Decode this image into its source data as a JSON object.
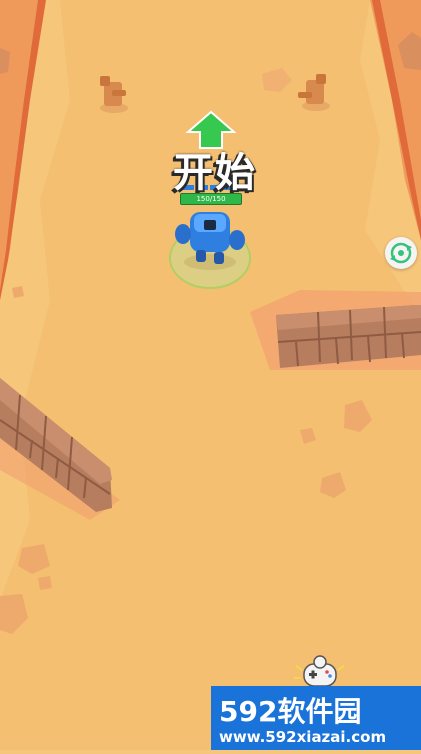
{
  "hud": {
    "start_label": "开始",
    "player_hp": "150/150",
    "hp_fraction": 1.0
  },
  "icons": {
    "player_arrow": "up-arrow-icon",
    "side_button": "refresh-icon",
    "controller": "gamepad-icon"
  },
  "watermark": {
    "title": "592软件园",
    "url": "www.592xiazai.com"
  },
  "colors": {
    "sand": "#f6c67a",
    "wall_brick": "#b77d5f",
    "player_blue": "#2f7fe0",
    "arrow_green": "#37c94f",
    "hp_green": "#2fb84a",
    "watermark_blue": "#1a73d8"
  }
}
